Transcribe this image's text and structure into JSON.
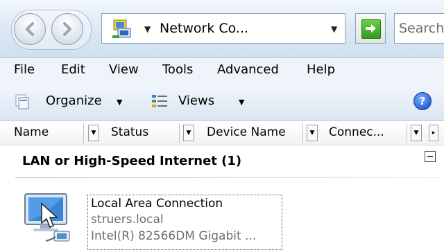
{
  "address_bar": {
    "location": "Network Co...",
    "search_placeholder": "Search"
  },
  "menu": {
    "items": [
      "File",
      "Edit",
      "View",
      "Tools",
      "Advanced",
      "Help"
    ]
  },
  "command_bar": {
    "organize_label": "Organize",
    "views_label": "Views",
    "help_label": "?"
  },
  "columns": [
    "Name",
    "Status",
    "Device Name",
    "Connec..."
  ],
  "group": {
    "title": "LAN or High-Speed Internet (1)",
    "items": [
      {
        "name": "Local Area Connection",
        "domain": "struers.local",
        "device": "Intel(R) 82566DM Gigabit ..."
      }
    ]
  },
  "colors": {
    "toolbar_gradient_top": "#f3f8fc",
    "toolbar_gradient_bottom": "#cfdff0",
    "menu_bg": "#eff4fa",
    "subtext": "#6d6d6d",
    "group_rule": "#b7cbe6"
  },
  "icons": [
    "back-arrow-icon",
    "forward-arrow-icon",
    "network-connections-icon",
    "refresh-icon",
    "organize-icon",
    "views-icon",
    "help-icon",
    "network-connection-icon"
  ]
}
